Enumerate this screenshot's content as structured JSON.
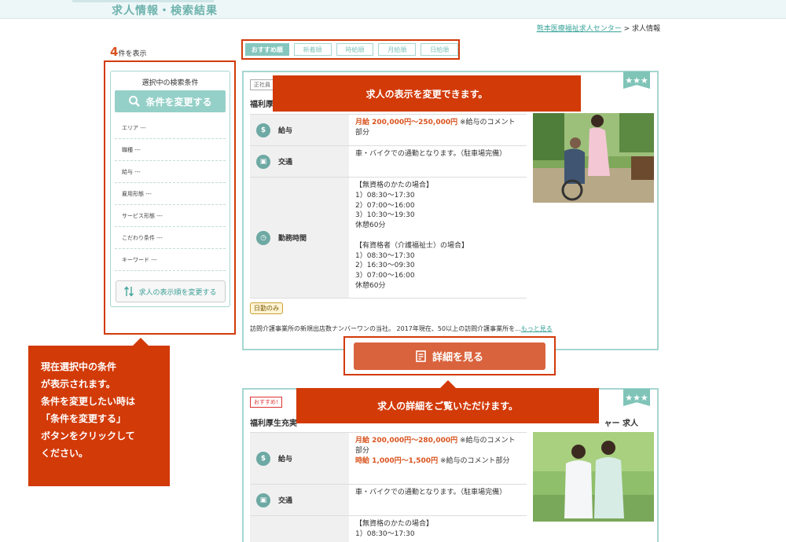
{
  "header": {
    "title": "求人情報・検索結果"
  },
  "breadcrumb": {
    "home": "熊本医療福祉求人センター",
    "sep": " > ",
    "current": "求人情報"
  },
  "results": {
    "count": "4",
    "count_suffix": "件を表示"
  },
  "sort_tabs": [
    "おすすめ順",
    "新着順",
    "時給順",
    "月給順",
    "日給順"
  ],
  "sidebar": {
    "heading": "選択中の検索条件",
    "change_button": "条件を変更する",
    "conditions": [
      "エリア ---",
      "職種 ---",
      "給与 ---",
      "雇用形態 ---",
      "サービス形態 ---",
      "こだわり条件 ---",
      "キーワード ---"
    ],
    "sort_button": "求人の表示順を変更する"
  },
  "job1": {
    "badge": "正社員",
    "title": "福利厚生",
    "stars": "★★★",
    "salary_label": "給与",
    "salary_value": "月給 200,000円〜250,000円",
    "salary_note": " ※給与のコメント部分",
    "transport_label": "交通",
    "transport_value": "車・バイクでの通勤となります。（駐車場完備）",
    "hours_label": "勤務時間",
    "hours_value": "【無資格のかたの場合】\n1）08:30〜17:30\n2）07:00〜16:00\n3）10:30〜19:30\n休憩60分\n\n【有資格者（介護福祉士）の場合】\n1）08:30〜17:30\n2）16:30〜09:30\n3）07:00〜16:00\n休憩60分",
    "tag": "日勤のみ",
    "description": "訪問介護事業所の新規出店数ナンバーワンの当社。 2017年現在、50以上の訪問介護事業所を...",
    "more": "もっと見る",
    "detail_button": "詳細を見る"
  },
  "job2": {
    "badge": "おすすめ!",
    "title": "福利厚生充実",
    "title_right": "ャー 求人",
    "stars": "★★★",
    "salary_label": "給与",
    "salary_value1": "月給 200,000円〜280,000円",
    "salary_note1": " ※給与のコメント部分",
    "salary_value2": "時給 1,000円〜1,500円",
    "salary_note2": " ※給与のコメント部分",
    "transport_label": "交通",
    "transport_value": "車・バイクでの通勤となります。（駐車場完備）",
    "hours_value": "【無資格のかたの場合】\n1）08:30〜17:30"
  },
  "callouts": {
    "top": "求人の表示を変更できます。",
    "left": "現在選択中の条件\nが表示されます。\n条件を変更したい時は\n「条件を変更する」\nボタンをクリックして\nください。",
    "bottom": "求人の詳細をご覧いただけます。"
  },
  "icons": {
    "salary": "yen-icon",
    "transport": "train-icon",
    "hours": "clock-icon",
    "search": "search-icon",
    "sort": "sort-arrows-icon",
    "detail": "document-icon"
  },
  "colors": {
    "accent": "#85c6be",
    "callout": "#d23a08",
    "button": "#d9633d",
    "pay": "#d9531e"
  }
}
